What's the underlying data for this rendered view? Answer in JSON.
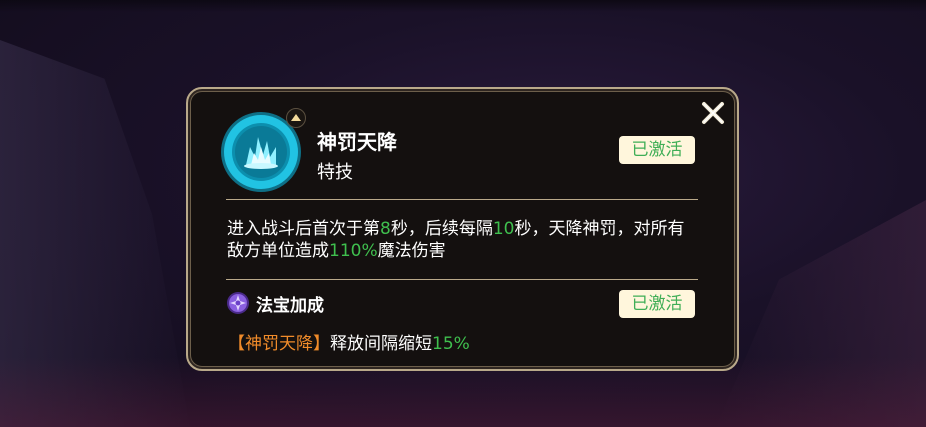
{
  "skill": {
    "name": "神罚天降",
    "type": "特技",
    "status": "已激活",
    "icon": "divine-punishment-icon",
    "upgrade_icon": "upgrade-arrow-icon"
  },
  "description": {
    "part1": "进入战斗后首次于第",
    "first_delay": "8",
    "part2": "秒，后续每隔",
    "interval": "10",
    "part3": "秒，天降神罚，对所有敌方单位造成",
    "damage": "110%",
    "part4": "魔法伤害"
  },
  "treasure_bonus": {
    "title": "法宝加成",
    "status": "已激活",
    "icon": "treasure-icon",
    "skill_ref": "【神罚天降】",
    "text": "释放间隔缩短",
    "value": "15%"
  },
  "close_icon": "close-icon",
  "colors": {
    "highlight_green": "#3fbf4e",
    "skill_ref_orange": "#f08b2a",
    "panel_border": "#b9a98a",
    "badge_bg": "#fff6dc",
    "skill_icon_cyan": "#25c9e6"
  }
}
